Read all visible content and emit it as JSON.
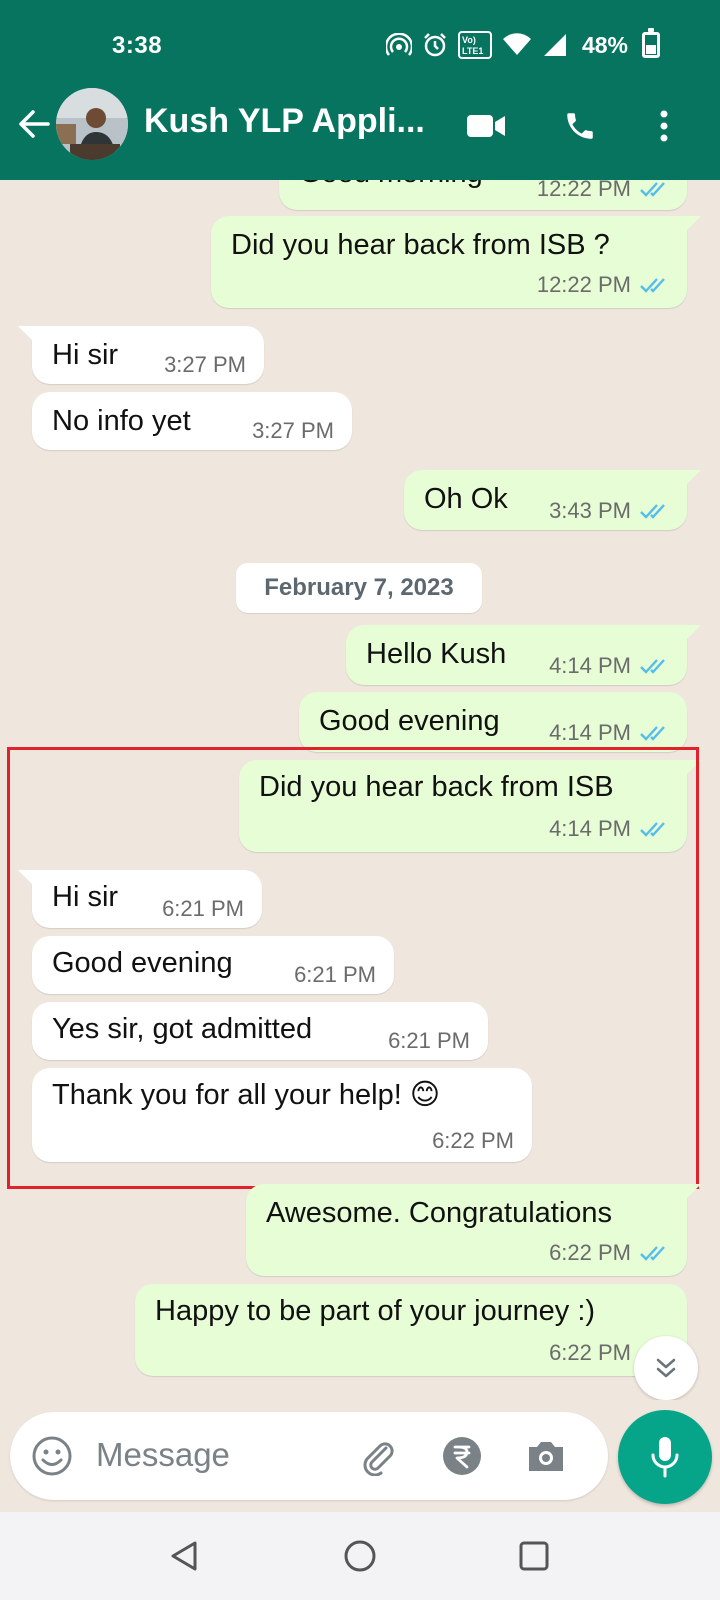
{
  "status_bar": {
    "time": "3:38",
    "battery": "48%"
  },
  "header": {
    "contact_name": "Kush YLP Appli..."
  },
  "messages": [
    {
      "dir": "out",
      "text": "Good morning",
      "time": "12:22 PM"
    },
    {
      "dir": "out",
      "text": "Did you hear back from ISB ?",
      "time": "12:22 PM"
    },
    {
      "dir": "in",
      "text": "Hi sir",
      "time": "3:27 PM"
    },
    {
      "dir": "in",
      "text": "No info yet",
      "time": "3:27 PM"
    },
    {
      "dir": "out",
      "text": "Oh Ok",
      "time": "3:43 PM"
    },
    {
      "dir": "out",
      "text": "Hello Kush",
      "time": "4:14 PM"
    },
    {
      "dir": "out",
      "text": "Good evening",
      "time": "4:14 PM"
    },
    {
      "dir": "out",
      "text": "Did you hear back from ISB",
      "time": "4:14 PM"
    },
    {
      "dir": "in",
      "text": "Hi sir",
      "time": "6:21 PM"
    },
    {
      "dir": "in",
      "text": "Good evening",
      "time": "6:21 PM"
    },
    {
      "dir": "in",
      "text": "Yes sir, got admitted",
      "time": "6:21 PM"
    },
    {
      "dir": "in",
      "text": "Thank you for all your help! 😊",
      "time": "6:22 PM"
    },
    {
      "dir": "out",
      "text": "Awesome. Congratulations",
      "time": "6:22 PM"
    },
    {
      "dir": "out",
      "text": "Happy to be part of your journey :)",
      "time": "6:22 PM"
    }
  ],
  "date_divider": "February 7, 2023",
  "composer": {
    "placeholder": "Message"
  },
  "colors": {
    "header": "#07745f",
    "outgoing": "#e7fdd6",
    "incoming": "#ffffff",
    "read_ticks": "#53bdeb",
    "mic": "#06a58a",
    "highlight": "#e0232b"
  },
  "icons": [
    "back-arrow-icon",
    "video-call-icon",
    "voice-call-icon",
    "more-vert-icon",
    "emoji-icon",
    "attach-icon",
    "rupee-payment-icon",
    "camera-icon",
    "mic-icon",
    "scroll-down-icon",
    "read-ticks-icon"
  ]
}
